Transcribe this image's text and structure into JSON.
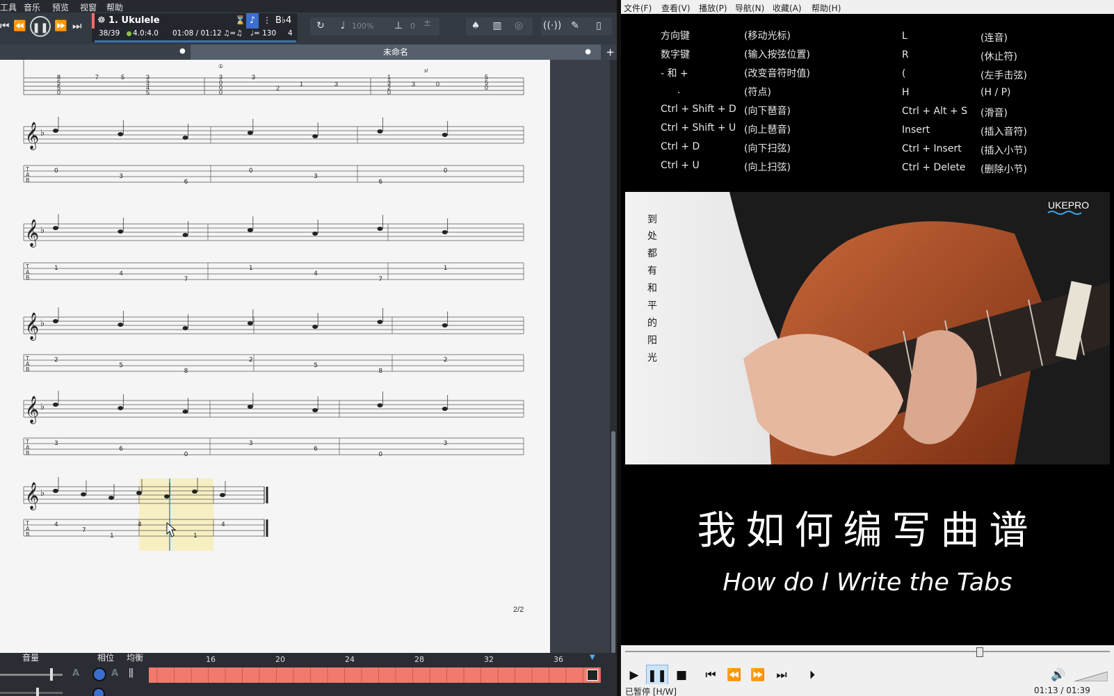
{
  "left_app": {
    "menu": [
      "工具",
      "音乐",
      "预览",
      "视窗",
      "帮助"
    ],
    "track_name": "1. Ukulele",
    "key_sig": "B♭4",
    "bar_counter": "38/39",
    "time_sig": "4.0:4.0",
    "time": "01:08 / 01:12",
    "tempo_marker": "♩= 130",
    "volume_pct": "100%",
    "capo_value": "0",
    "tab_title": "未命名",
    "page_number": "2/2",
    "bottom_labels": [
      "音量",
      "相位",
      "均衡"
    ],
    "timeline_ticks": [
      "16",
      "20",
      "24",
      "28",
      "32",
      "36"
    ]
  },
  "player": {
    "menu": [
      "文件(F)",
      "查看(V)",
      "播放(P)",
      "导航(N)",
      "收藏(A)",
      "帮助(H)"
    ],
    "shortcuts_left": [
      {
        "key": "方向键",
        "desc": "(移动光标)"
      },
      {
        "key": "数字键",
        "desc": "(输入按弦位置)"
      },
      {
        "key": "- 和 +",
        "desc": "(改变音符时值)"
      },
      {
        "key": ".",
        "desc": "(符点)"
      },
      {
        "key": "Ctrl + Shift + D",
        "desc": "(向下琶音)"
      },
      {
        "key": "Ctrl + Shift + U",
        "desc": "(向上琶音)"
      },
      {
        "key": "Ctrl + D",
        "desc": "(向下扫弦)"
      },
      {
        "key": "Ctrl + U",
        "desc": "(向上扫弦)"
      }
    ],
    "shortcuts_right": [
      {
        "key": "L",
        "desc": "(连音)"
      },
      {
        "key": "R",
        "desc": "(休止符)"
      },
      {
        "key": "(",
        "desc": "(左手击弦)"
      },
      {
        "key": "H",
        "desc": "(H / P)"
      },
      {
        "key": "Ctrl + Alt + S",
        "desc": "(滑音)"
      },
      {
        "key": "Insert",
        "desc": "(插入音符)"
      },
      {
        "key": "Ctrl + Insert",
        "desc": "(插入小节)"
      },
      {
        "key": "Ctrl + Delete",
        "desc": "(删除小节)"
      }
    ],
    "brand": "UKEPRO",
    "vertical_poem": "到处都有和平的阳光",
    "title_cn": "我如何编写曲谱",
    "title_en": "How do I Write the Tabs",
    "status": "已暂停 [H/W]",
    "time": "01:13 / 01:39"
  }
}
